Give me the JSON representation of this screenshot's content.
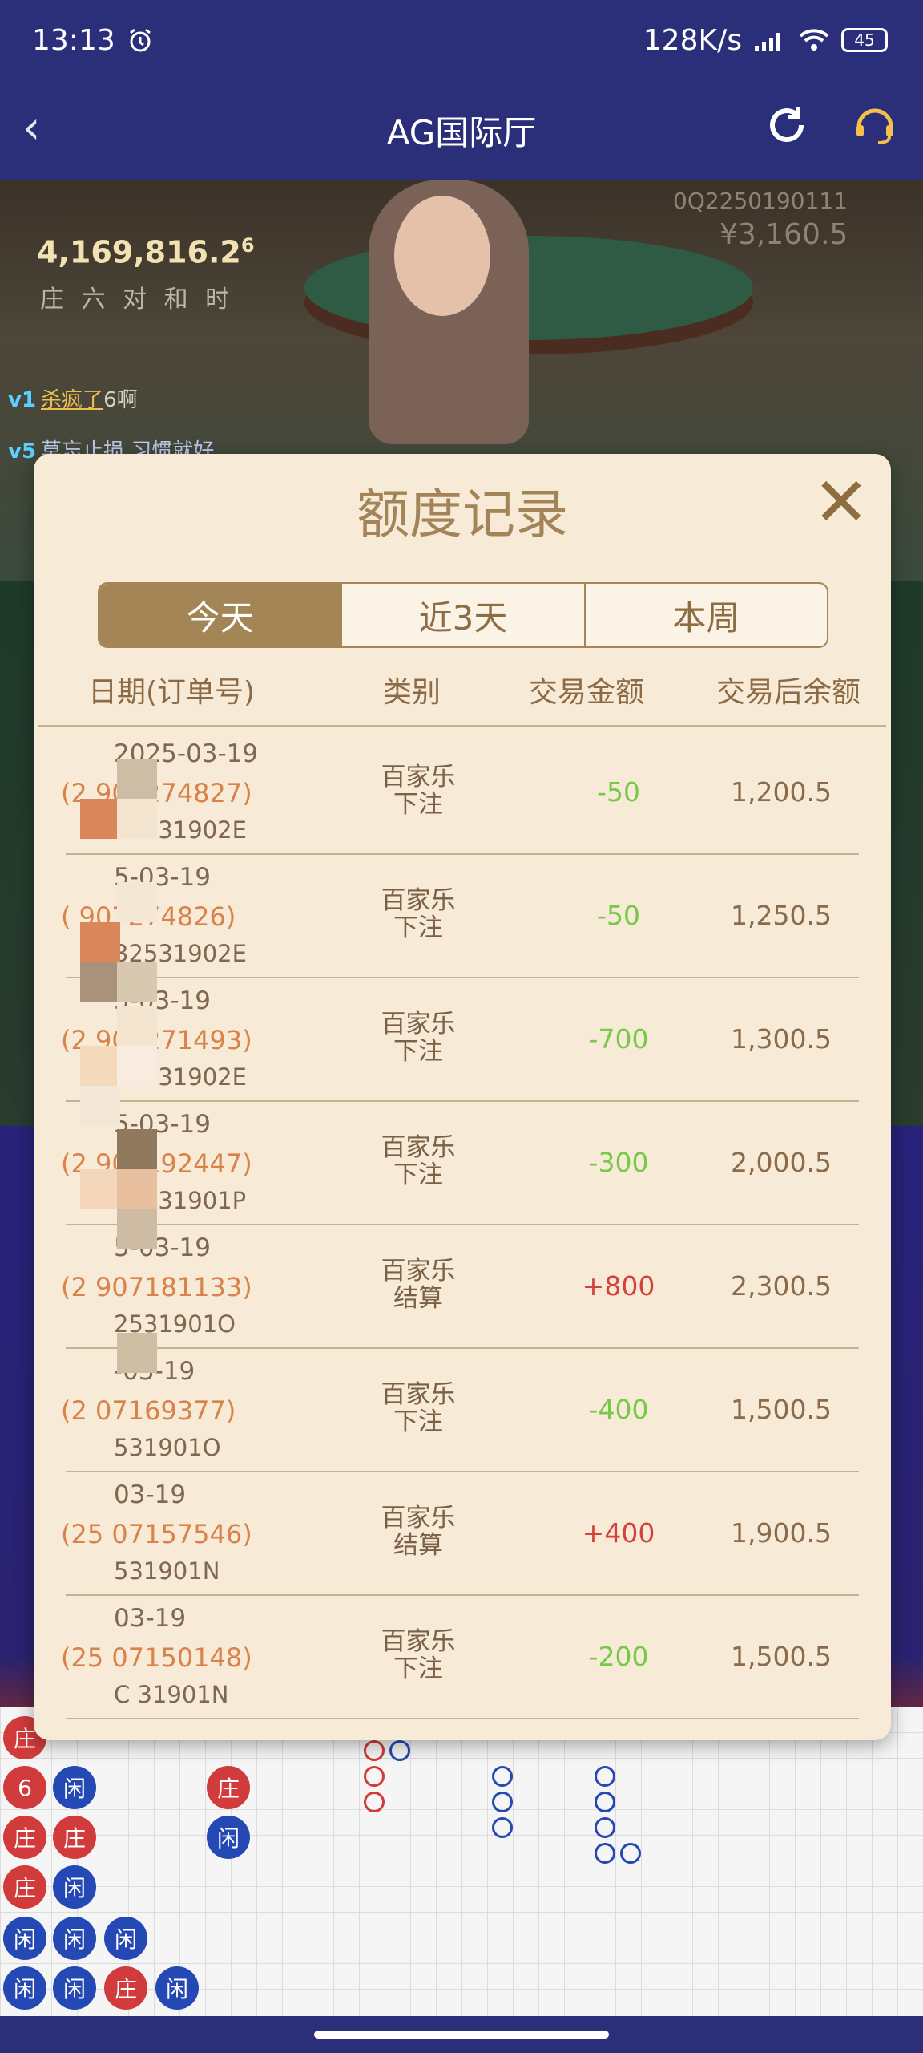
{
  "status_bar": {
    "time": "13:13",
    "net_speed": "128K/s",
    "battery": "45"
  },
  "nav": {
    "back_icon": "chevron-left-icon",
    "title": "AG国际厅",
    "refresh_icon": "refresh-icon",
    "service_icon": "headset-icon"
  },
  "video": {
    "jackpot": "4,169,816.2",
    "jackpot_tail": "6",
    "bet_kinds": "庄 六 对 和 时",
    "user_id": "0Q2250190111",
    "balance": "¥3,160.5",
    "chat": [
      {
        "level": "v1",
        "name": "杀疯了",
        "text": "6啊"
      },
      {
        "level": "v5",
        "name": "",
        "text": "莫忘止损 习惯就好"
      }
    ]
  },
  "dialog": {
    "title": "额度记录",
    "close_label": "✕",
    "tabs": [
      {
        "label": "今天",
        "active": true
      },
      {
        "label": "近3天",
        "active": false
      },
      {
        "label": "本周",
        "active": false
      }
    ],
    "columns": {
      "date": "日期(订单号)",
      "type": "类别",
      "amount": "交易金额",
      "balance": "交易后余额"
    },
    "rows": [
      {
        "date": "2025-03-19",
        "order": "(2     907274827)",
        "sub": "32531902E",
        "type1": "百家乐",
        "type2": "下注",
        "amount": "-50",
        "balance": "1,200.5",
        "positive": false
      },
      {
        "date": "5-03-19",
        "order": "(     907274826)",
        "sub": "32531902E",
        "type1": "百家乐",
        "type2": "下注",
        "amount": "-50",
        "balance": "1,250.5",
        "positive": false
      },
      {
        "date": "5-03-19",
        "order": "(2     907271493)",
        "sub": "32531902E",
        "type1": "百家乐",
        "type2": "下注",
        "amount": "-700",
        "balance": "1,300.5",
        "positive": false
      },
      {
        "date": "5-03-19",
        "order": "(2     907192447)",
        "sub": "12531901P",
        "type1": "百家乐",
        "type2": "下注",
        "amount": "-300",
        "balance": "2,000.5",
        "positive": false
      },
      {
        "date": "5-03-19",
        "order": "(2     907181133)",
        "sub": "2531901O",
        "type1": "百家乐",
        "type2": "结算",
        "amount": "+800",
        "balance": "2,300.5",
        "positive": true
      },
      {
        "date": "-03-19",
        "order": "(2     07169377)",
        "sub": "531901O",
        "type1": "百家乐",
        "type2": "下注",
        "amount": "-400",
        "balance": "1,500.5",
        "positive": false
      },
      {
        "date": "03-19",
        "order": "(25     07157546)",
        "sub": "531901N",
        "type1": "百家乐",
        "type2": "结算",
        "amount": "+400",
        "balance": "1,900.5",
        "positive": true
      },
      {
        "date": "03-19",
        "order": "(25     07150148)",
        "sub": "C     31901N",
        "type1": "百家乐",
        "type2": "下注",
        "amount": "-200",
        "balance": "1,500.5",
        "positive": false
      }
    ]
  },
  "road": {
    "banker_label": "庄",
    "player_label": "闲",
    "pair_label": "6"
  }
}
